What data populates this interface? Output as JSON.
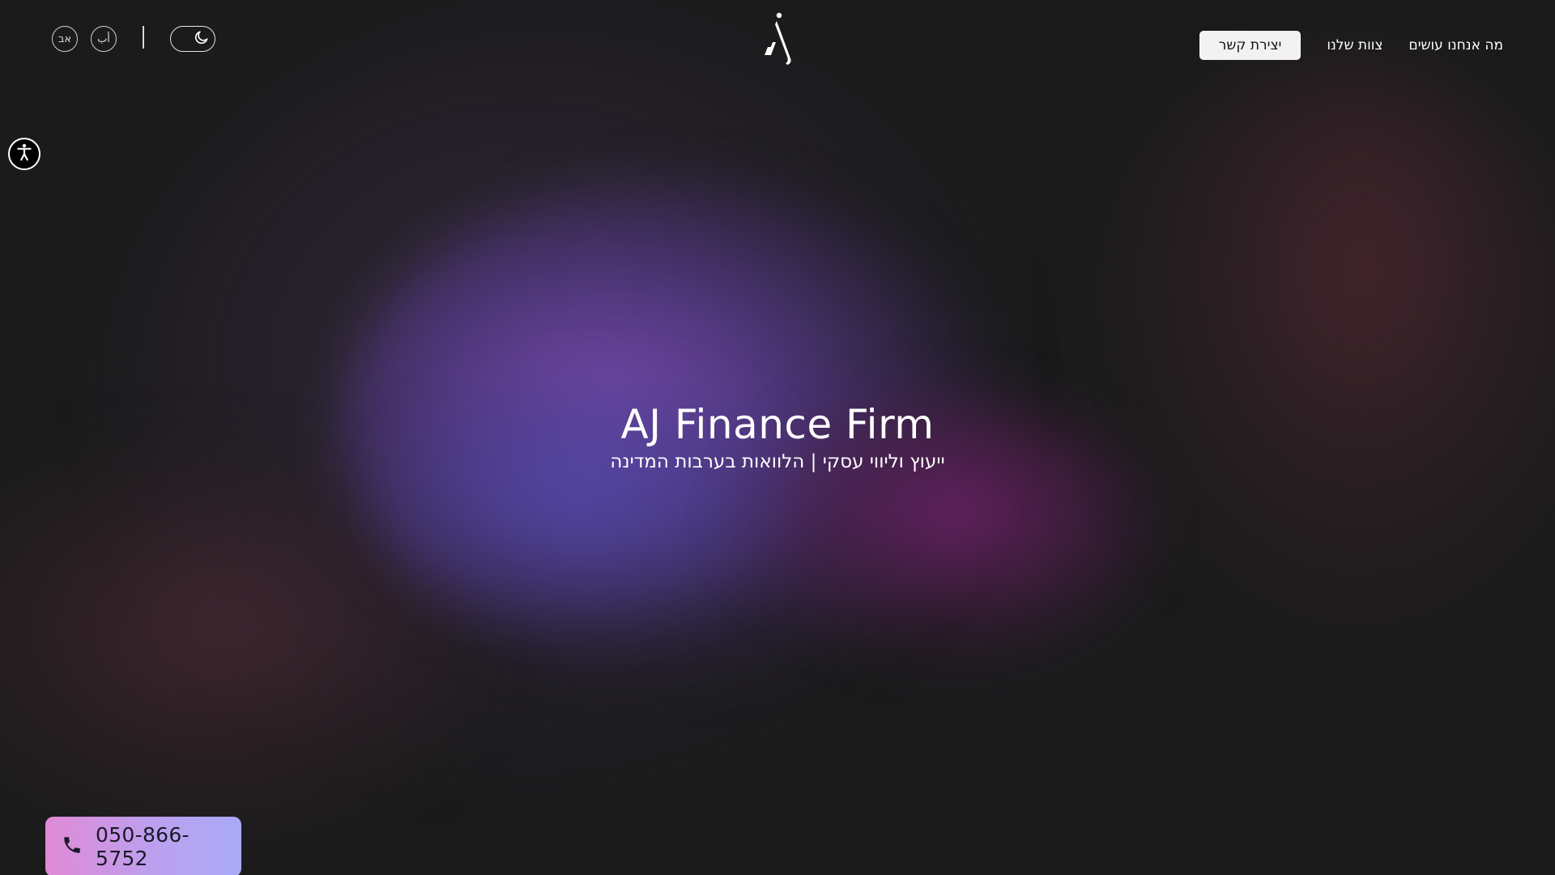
{
  "header": {
    "lang_buttons": [
      {
        "label": "אב"
      },
      {
        "label": "أب"
      }
    ],
    "theme_toggle": {
      "icon": "moon-icon",
      "state": "dark"
    },
    "logo": {
      "icon": "aj-logo-icon"
    },
    "nav": {
      "items": [
        {
          "label": "מה אנחנו עושים"
        },
        {
          "label": "צוות שלנו"
        }
      ],
      "contact_label": "יצירת קשר"
    }
  },
  "accessibility": {
    "icon": "accessibility-icon"
  },
  "hero": {
    "title": "AJ Finance Firm",
    "subtitle": "ייעוץ וליווי עסקי | הלוואות בערבות המדינה"
  },
  "phone": {
    "icon": "phone-icon",
    "number": "050-866-5752"
  },
  "colors": {
    "background": "#1b1b1c",
    "accent_violet": "#7c4cb2",
    "accent_magenta": "#70226c",
    "phone_gradient_start": "#e08ad6",
    "phone_gradient_end": "#a8aaf8"
  }
}
